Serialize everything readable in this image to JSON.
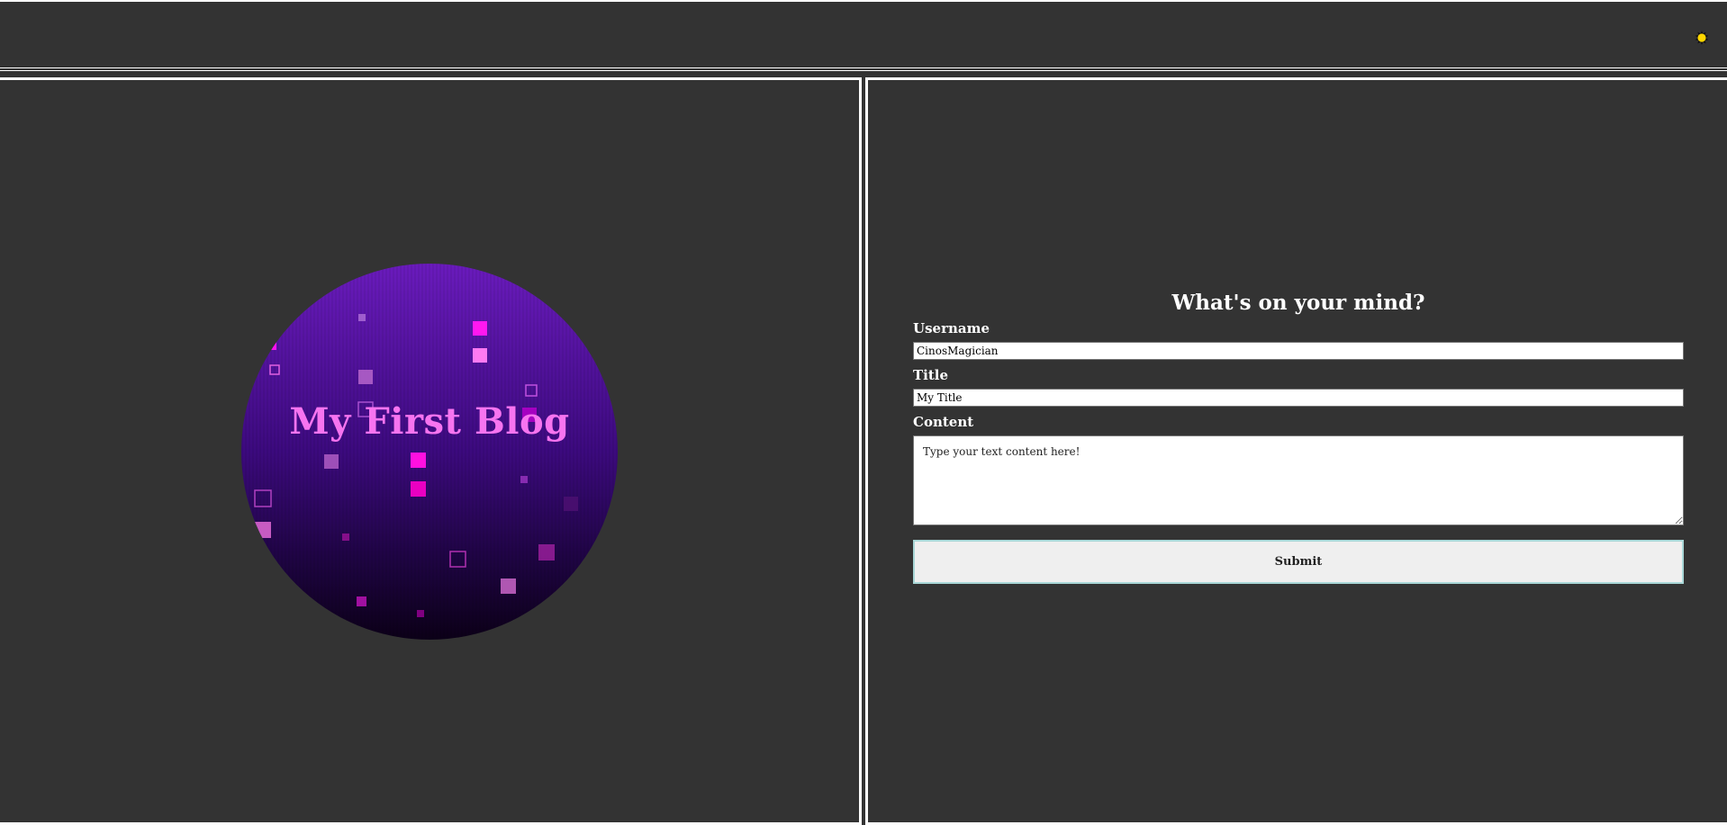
{
  "header": {
    "theme_toggle_icon": "sun-icon",
    "theme_toggle_color": "#ffd700"
  },
  "hero": {
    "title": "My First Blog",
    "title_color": "#f774f0",
    "background_colors": [
      "#6a1bbd",
      "#3c0a7e",
      "#0c0018"
    ],
    "accent_color": "#ff00ee"
  },
  "form": {
    "heading": "What's on your mind?",
    "username_label": "Username",
    "username_value": "CinosMagician",
    "title_label": "Title",
    "title_value": "My Title",
    "content_label": "Content",
    "content_placeholder": "Type your text content here!",
    "submit_label": "Submit"
  }
}
